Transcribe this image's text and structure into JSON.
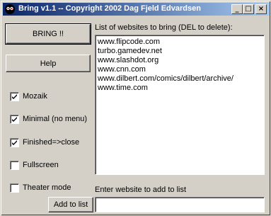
{
  "window": {
    "title": "Bring v1.1  --  Copyright 2002 Dag Fjeld Edvardsen",
    "minimize_glyph": "_",
    "maximize_glyph": "□",
    "close_glyph": "×"
  },
  "buttons": {
    "bring": "BRING !!",
    "help": "Help",
    "add": "Add to list"
  },
  "options": [
    {
      "label": "Mozaik",
      "checked": true
    },
    {
      "label": "Minimal (no menu)",
      "checked": true
    },
    {
      "label": "Finished=>close",
      "checked": true
    },
    {
      "label": "Fullscreen",
      "checked": false
    },
    {
      "label": "Theater mode",
      "checked": false
    }
  ],
  "list": {
    "header": "List of websites to bring (DEL to delete):",
    "items": [
      "www.flipcode.com",
      "turbo.gamedev.net",
      "www.slashdot.org",
      "www.cnn.com",
      "www.dilbert.com/comics/dilbert/archive/",
      "www.time.com"
    ]
  },
  "add_section": {
    "label": "Enter website to add to list",
    "input_value": ""
  }
}
